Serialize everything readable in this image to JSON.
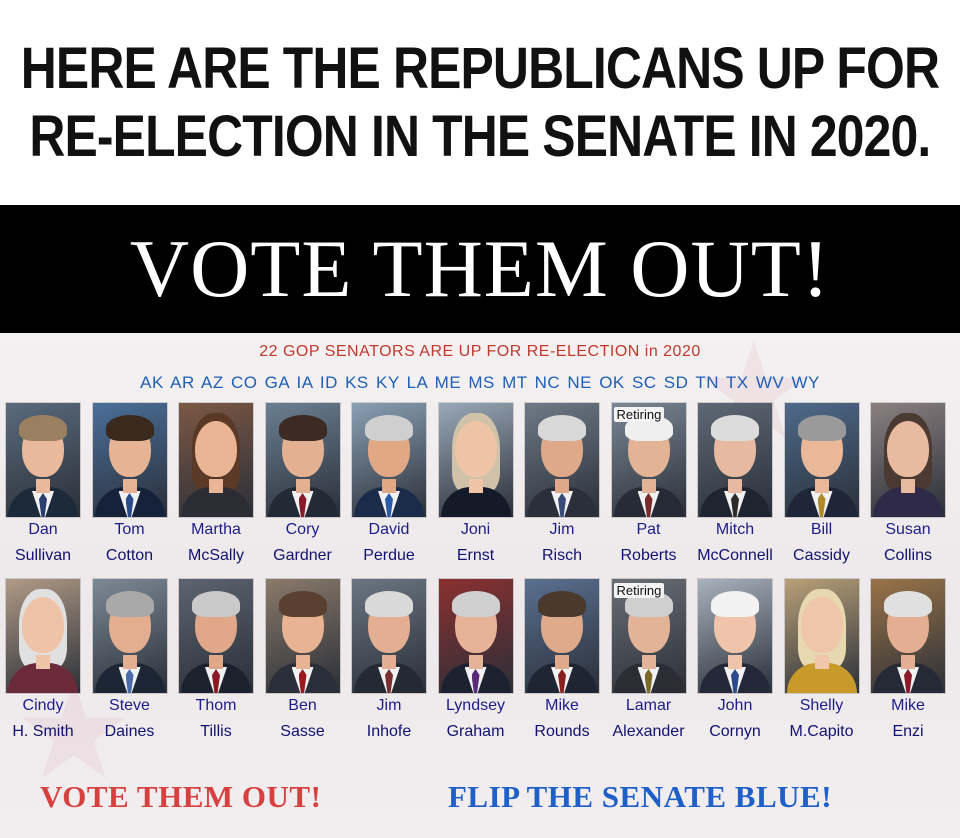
{
  "headline": {
    "line1": "HERE ARE THE REPUBLICANS UP FOR",
    "line2": "RE-ELECTION IN THE SENATE IN 2020."
  },
  "banner": {
    "text": "VOTE THEM OUT!"
  },
  "panel": {
    "subtitle": "22 GOP SENATORS ARE UP FOR RE-ELECTION in 2020",
    "states": "AK AR AZ CO GA IA ID KS KY LA ME MS MT NC NE OK SC SD TN TX WV WY"
  },
  "row1": [
    {
      "first": "Dan",
      "last": "Sullivan",
      "retiring": ""
    },
    {
      "first": "Tom",
      "last": "Cotton",
      "retiring": ""
    },
    {
      "first": "Martha",
      "last": "McSally",
      "retiring": ""
    },
    {
      "first": "Cory",
      "last": "Gardner",
      "retiring": ""
    },
    {
      "first": "David",
      "last": "Perdue",
      "retiring": ""
    },
    {
      "first": "Joni",
      "last": "Ernst",
      "retiring": ""
    },
    {
      "first": "Jim",
      "last": "Risch",
      "retiring": ""
    },
    {
      "first": "Pat",
      "last": "Roberts",
      "retiring": "Retiring"
    },
    {
      "first": "Mitch",
      "last": "McConnell",
      "retiring": ""
    },
    {
      "first": "Bill",
      "last": "Cassidy",
      "retiring": ""
    },
    {
      "first": "Susan",
      "last": "Collins",
      "retiring": ""
    }
  ],
  "row2": [
    {
      "first": "Cindy",
      "last": "H. Smith",
      "retiring": ""
    },
    {
      "first": "Steve",
      "last": "Daines",
      "retiring": ""
    },
    {
      "first": "Thom",
      "last": "Tillis",
      "retiring": ""
    },
    {
      "first": "Ben",
      "last": "Sasse",
      "retiring": ""
    },
    {
      "first": "Jim",
      "last": "Inhofe",
      "retiring": ""
    },
    {
      "first": "Lyndsey",
      "last": "Graham",
      "retiring": ""
    },
    {
      "first": "Mike",
      "last": "Rounds",
      "retiring": ""
    },
    {
      "first": "Lamar",
      "last": "Alexander",
      "retiring": "Retiring"
    },
    {
      "first": "John",
      "last": "Cornyn",
      "retiring": ""
    },
    {
      "first": "Shelly",
      "last": "M.Capito",
      "retiring": ""
    },
    {
      "first": "Mike",
      "last": "Enzi",
      "retiring": ""
    }
  ],
  "footer": {
    "left": "VOTE THEM OUT!",
    "right": "FLIP THE SENATE BLUE!"
  },
  "colors": {
    "red": "#d6413f",
    "blue": "#1f5fc8",
    "state_blue": "#1f5fb5"
  }
}
